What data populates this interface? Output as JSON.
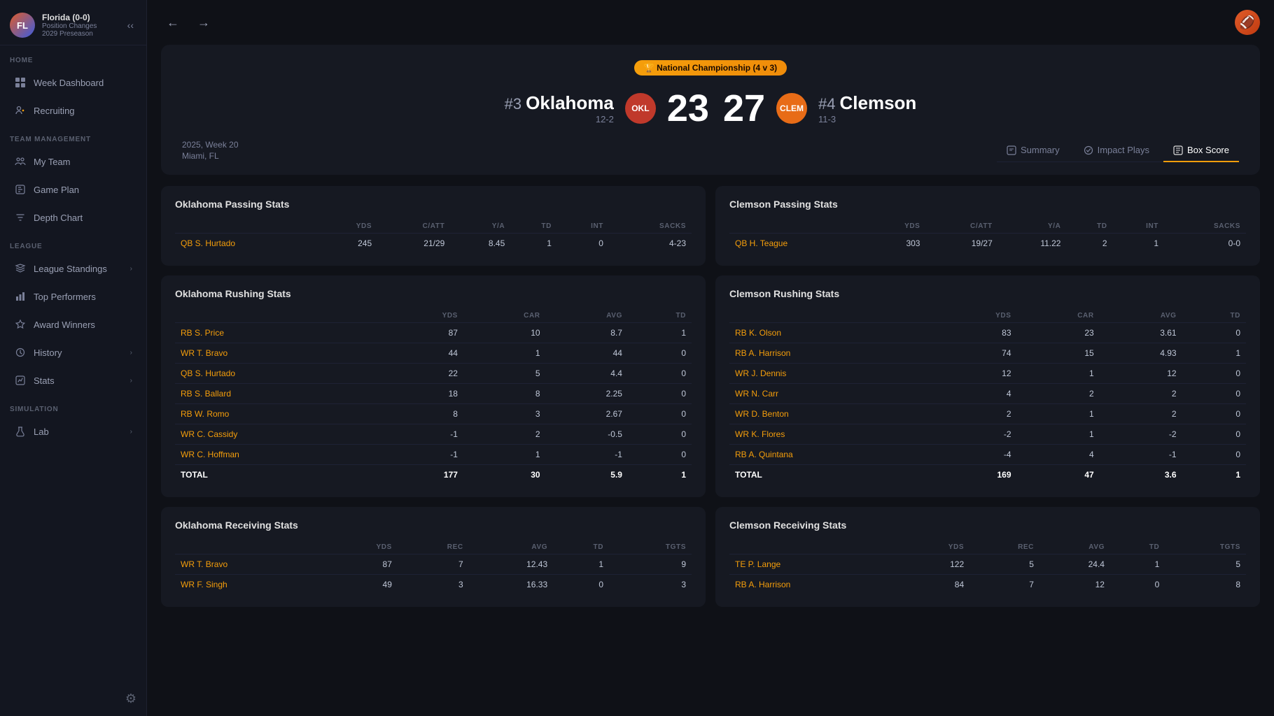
{
  "sidebar": {
    "user": {
      "initials": "FL",
      "name": "Florida (0-0)",
      "sub1": "Position Changes",
      "sub2": "2029 Preseason"
    },
    "sections": [
      {
        "label": "HOME",
        "items": [
          {
            "id": "week-dashboard",
            "label": "Week Dashboard",
            "icon": "grid",
            "hasChevron": false
          },
          {
            "id": "recruiting",
            "label": "Recruiting",
            "icon": "users-plus",
            "hasChevron": false
          }
        ]
      },
      {
        "label": "TEAM MANAGEMENT",
        "items": [
          {
            "id": "my-team",
            "label": "My Team",
            "icon": "team",
            "hasChevron": false
          },
          {
            "id": "game-plan",
            "label": "Game Plan",
            "icon": "gameplan",
            "hasChevron": false
          },
          {
            "id": "depth-chart",
            "label": "Depth Chart",
            "icon": "depth",
            "hasChevron": false
          }
        ]
      },
      {
        "label": "LEAGUE",
        "items": [
          {
            "id": "league-standings",
            "label": "League Standings",
            "icon": "layers",
            "hasChevron": true
          },
          {
            "id": "top-performers",
            "label": "Top Performers",
            "icon": "chart",
            "hasChevron": false
          },
          {
            "id": "award-winners",
            "label": "Award Winners",
            "icon": "star",
            "hasChevron": false
          },
          {
            "id": "history",
            "label": "History",
            "icon": "history",
            "hasChevron": true
          },
          {
            "id": "stats",
            "label": "Stats",
            "icon": "stats",
            "hasChevron": true
          }
        ]
      },
      {
        "label": "SIMULATION",
        "items": [
          {
            "id": "lab",
            "label": "Lab",
            "icon": "lab",
            "hasChevron": true
          }
        ]
      }
    ]
  },
  "topbar": {
    "backLabel": "←",
    "forwardLabel": "→",
    "emoji": "🏈"
  },
  "game": {
    "badge": "🏆 National Championship (4 v 3)",
    "team1": {
      "rank": "#3",
      "name": "Oklahoma",
      "record": "12-2",
      "abbr": "OKL",
      "score": "23"
    },
    "team2": {
      "rank": "#4",
      "name": "Clemson",
      "record": "11-3",
      "abbr": "CLEM",
      "score": "27"
    },
    "scoreDash": "",
    "meta": {
      "weekLine": "2025, Week 20",
      "locationLine": "Miami, FL"
    },
    "tabs": [
      {
        "id": "summary",
        "label": "Summary",
        "icon": "summary",
        "active": false
      },
      {
        "id": "impact-plays",
        "label": "Impact Plays",
        "icon": "impact",
        "active": false
      },
      {
        "id": "box-score",
        "label": "Box Score",
        "icon": "boxscore",
        "active": true
      }
    ]
  },
  "oklPassingStats": {
    "title": "Oklahoma Passing Stats",
    "headers": [
      "",
      "YDS",
      "C/ATT",
      "Y/A",
      "TD",
      "INT",
      "SACKS"
    ],
    "rows": [
      {
        "player": "QB S. Hurtado",
        "yds": "245",
        "catt": "21/29",
        "ya": "8.45",
        "td": "1",
        "int": "0",
        "sacks": "4-23"
      }
    ]
  },
  "clemPassingStats": {
    "title": "Clemson Passing Stats",
    "headers": [
      "",
      "YDS",
      "C/ATT",
      "Y/A",
      "TD",
      "INT",
      "SACKS"
    ],
    "rows": [
      {
        "player": "QB H. Teague",
        "yds": "303",
        "catt": "19/27",
        "ya": "11.22",
        "td": "2",
        "int": "1",
        "sacks": "0-0"
      }
    ]
  },
  "oklRushingStats": {
    "title": "Oklahoma Rushing Stats",
    "headers": [
      "",
      "YDS",
      "CAR",
      "AVG",
      "TD"
    ],
    "rows": [
      {
        "player": "RB S. Price",
        "yds": "87",
        "car": "10",
        "avg": "8.7",
        "td": "1"
      },
      {
        "player": "WR T. Bravo",
        "yds": "44",
        "car": "1",
        "avg": "44",
        "td": "0"
      },
      {
        "player": "QB S. Hurtado",
        "yds": "22",
        "car": "5",
        "avg": "4.4",
        "td": "0"
      },
      {
        "player": "RB S. Ballard",
        "yds": "18",
        "car": "8",
        "avg": "2.25",
        "td": "0"
      },
      {
        "player": "RB W. Romo",
        "yds": "8",
        "car": "3",
        "avg": "2.67",
        "td": "0"
      },
      {
        "player": "WR C. Cassidy",
        "yds": "-1",
        "car": "2",
        "avg": "-0.5",
        "td": "0"
      },
      {
        "player": "WR C. Hoffman",
        "yds": "-1",
        "car": "1",
        "avg": "-1",
        "td": "0"
      }
    ],
    "total": {
      "label": "TOTAL",
      "yds": "177",
      "car": "30",
      "avg": "5.9",
      "td": "1"
    }
  },
  "clemRushingStats": {
    "title": "Clemson Rushing Stats",
    "headers": [
      "",
      "YDS",
      "CAR",
      "AVG",
      "TD"
    ],
    "rows": [
      {
        "player": "RB K. Olson",
        "yds": "83",
        "car": "23",
        "avg": "3.61",
        "td": "0"
      },
      {
        "player": "RB A. Harrison",
        "yds": "74",
        "car": "15",
        "avg": "4.93",
        "td": "1"
      },
      {
        "player": "WR J. Dennis",
        "yds": "12",
        "car": "1",
        "avg": "12",
        "td": "0"
      },
      {
        "player": "WR N. Carr",
        "yds": "4",
        "car": "2",
        "avg": "2",
        "td": "0"
      },
      {
        "player": "WR D. Benton",
        "yds": "2",
        "car": "1",
        "avg": "2",
        "td": "0"
      },
      {
        "player": "WR K. Flores",
        "yds": "-2",
        "car": "1",
        "avg": "-2",
        "td": "0"
      },
      {
        "player": "RB A. Quintana",
        "yds": "-4",
        "car": "4",
        "avg": "-1",
        "td": "0"
      }
    ],
    "total": {
      "label": "TOTAL",
      "yds": "169",
      "car": "47",
      "avg": "3.6",
      "td": "1"
    }
  },
  "oklReceivingStats": {
    "title": "Oklahoma Receiving Stats",
    "headers": [
      "",
      "YDS",
      "REC",
      "AVG",
      "TD",
      "TGTS"
    ],
    "rows": [
      {
        "player": "WR T. Bravo",
        "yds": "87",
        "rec": "7",
        "avg": "12.43",
        "td": "1",
        "tgts": "9"
      },
      {
        "player": "WR F. Singh",
        "yds": "49",
        "rec": "3",
        "avg": "16.33",
        "td": "0",
        "tgts": "3"
      }
    ]
  },
  "clemReceivingStats": {
    "title": "Clemson Receiving Stats",
    "headers": [
      "",
      "YDS",
      "REC",
      "AVG",
      "TD",
      "TGTS"
    ],
    "rows": [
      {
        "player": "TE P. Lange",
        "yds": "122",
        "rec": "5",
        "avg": "24.4",
        "td": "1",
        "tgts": "5"
      },
      {
        "player": "RB A. Harrison",
        "yds": "84",
        "rec": "7",
        "avg": "12",
        "td": "0",
        "tgts": "8"
      }
    ]
  }
}
